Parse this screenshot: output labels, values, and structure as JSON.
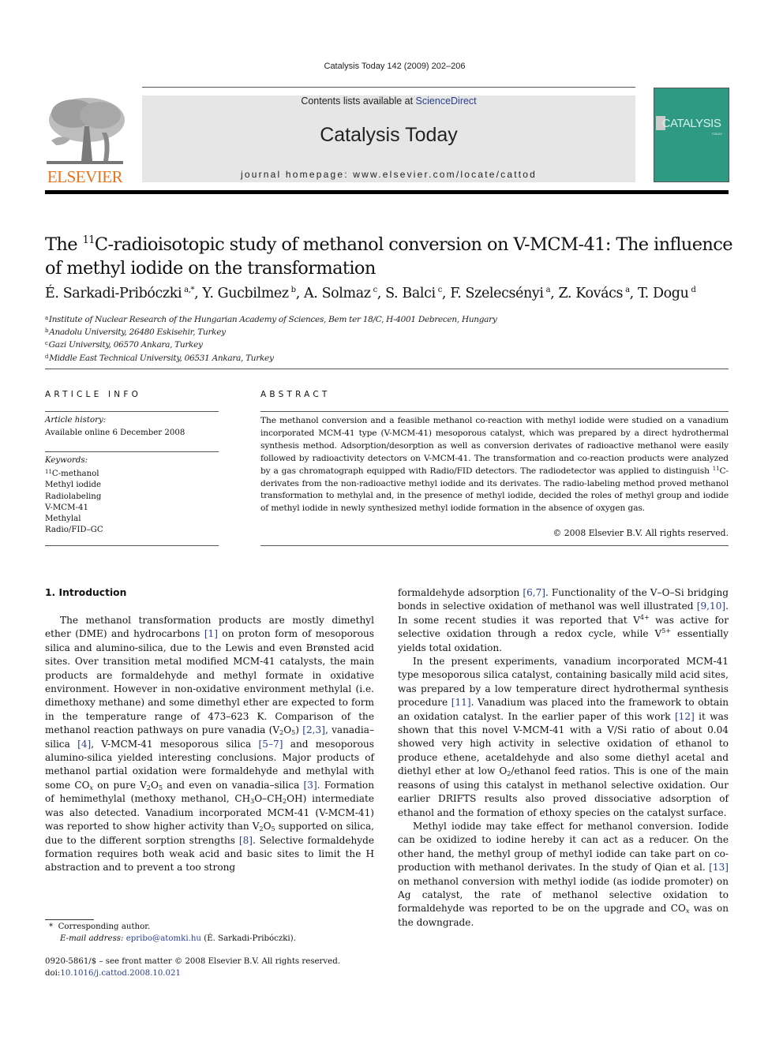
{
  "running_head": "Catalysis Today 142 (2009) 202–206",
  "publisher": {
    "logo_text": "ELSEVIER",
    "logo_icon": "elsevier-tree-icon",
    "brand_color": "#e8731a"
  },
  "banner": {
    "contents_prefix": "Contents lists available at ",
    "contents_link": "ScienceDirect",
    "journal_title": "Catalysis Today",
    "homepage": "journal homepage: www.elsevier.com/locate/cattod",
    "background_color": "#e6e6e6"
  },
  "cover": {
    "title": "CATALYSIS",
    "subtitle": "TODAY",
    "color": "#2e9a83"
  },
  "article": {
    "title_prefix": "The ",
    "title_sup": "11",
    "title_rest": "C-radioisotopic study of methanol conversion on V-MCM-41: The influence of methyl iodide on the transformation",
    "authors": [
      {
        "name": "É. Sarkadi-Pribóczki",
        "sup": "a,*"
      },
      {
        "name": "Y. Gucbilmez",
        "sup": "b"
      },
      {
        "name": "A. Solmaz",
        "sup": "c"
      },
      {
        "name": "S. Balci",
        "sup": "c"
      },
      {
        "name": "F. Szelecsényi",
        "sup": "a"
      },
      {
        "name": "Z. Kovács",
        "sup": "a"
      },
      {
        "name": "T. Dogu",
        "sup": "d"
      }
    ],
    "affiliations": [
      {
        "key": "a",
        "text": "Institute of Nuclear Research of the Hungarian Academy of Sciences, Bem ter 18/C, H-4001 Debrecen, Hungary"
      },
      {
        "key": "b",
        "text": "Anadolu University, 26480 Eskisehir, Turkey"
      },
      {
        "key": "c",
        "text": "Gazi University, 06570 Ankara, Turkey"
      },
      {
        "key": "d",
        "text": "Middle East Technical University, 06531 Ankara, Turkey"
      }
    ]
  },
  "article_info": {
    "heading": "ARTICLE INFO",
    "history_label": "Article history:",
    "history_value": "Available online 6 December 2008",
    "keywords_label": "Keywords:",
    "keywords": [
      "C-methanol",
      "Methyl iodide",
      "Radiolabeling",
      "V-MCM-41",
      "Methylal",
      "Radio/FID–GC"
    ],
    "keyword0_sup": "11"
  },
  "abstract": {
    "heading": "ABSTRACT",
    "part1": "The methanol conversion and a feasible methanol co-reaction with methyl iodide were studied on a vanadium incorporated MCM-41 type (V-MCM-41) mesoporous catalyst, which was prepared by a direct hydrothermal synthesis method. Adsorption/desorption as well as conversion derivates of radioactive methanol were easily followed by radioactivity detectors on V-MCM-41. The transformation and co-reaction products were analyzed by a gas chromatograph equipped with Radio/FID detectors. The radiodetector was applied to distinguish ",
    "sup": "11",
    "part2": "C-derivates from the non-radioactive methyl iodide and its derivates. The radio-labeling method proved methanol transformation to methylal and, in the presence of methyl iodide, decided the roles of methyl group and iodide of methyl iodide in newly synthesized methyl iodide formation in the absence of oxygen gas.",
    "copyright": "© 2008 Elsevier B.V. All rights reserved."
  },
  "introduction": {
    "heading": "1.  Introduction",
    "left": {
      "t1": "The methanol transformation products are mostly dimethyl ether (DME) and hydrocarbons ",
      "r1": "[1]",
      "t2": " on proton form of mesoporous silica and alumino-silica, due to the Lewis and even Brønsted acid sites. Over transition metal modified MCM-41 catalysts, the main products are formaldehyde and methyl formate in oxidative environment. However in non-oxidative environment methylal (i.e. dimethoxy methane) and some dimethyl ether are expected to form in the temperature range of 473–623 K. Comparison of the methanol reaction pathways on pure vanadia (V",
      "s1": "2",
      "t3": "O",
      "s2": "5",
      "t4": ") ",
      "r2": "[2,3]",
      "t5": ", vanadia–silica ",
      "r3": "[4]",
      "t6": ", V-MCM-41 mesoporous silica ",
      "r4": "[5–7]",
      "t7": " and mesoporous alumino-silica yielded interesting conclusions. Major products of methanol partial oxidation were formaldehyde and methylal with some CO",
      "s3": "x",
      "t8": " on pure V",
      "s4": "2",
      "t9": "O",
      "s5": "5",
      "t10": " and even on vanadia–silica ",
      "r5": "[3]",
      "t11": ". Formation of hemimethylal (methoxy methanol, CH",
      "s6": "3",
      "t12": "O–CH",
      "s7": "2",
      "t13": "OH) intermediate was also detected. Vanadium incorporated MCM-41 (V-MCM-41) was reported to show higher activity than V",
      "s8": "2",
      "t14": "O",
      "s9": "5",
      "t15": " supported on silica, due to the different sorption strengths ",
      "r6": "[8]",
      "t16": ". Selective formaldehyde formation requires both weak acid and basic sites to limit the H abstraction and to prevent a too strong"
    },
    "right": {
      "p1_t1": "formaldehyde adsorption ",
      "p1_r1": "[6,7]",
      "p1_t2": ". Functionality of the V–O–Si bridging bonds in selective oxidation of methanol was well illustrated ",
      "p1_r2": "[9,10]",
      "p1_t3": ". In some recent studies it was reported that V",
      "p1_sup1": "4+",
      "p1_t4": " was active for selective oxidation through a redox cycle, while V",
      "p1_sup2": "5+",
      "p1_t5": " essentially yields total oxidation.",
      "p2_t1": "In the present experiments, vanadium incorporated MCM-41 type mesoporous silica catalyst, containing basically mild acid sites, was prepared by a low temperature direct hydrothermal synthesis procedure ",
      "p2_r1": "[11]",
      "p2_t2": ". Vanadium was placed into the framework to obtain an oxidation catalyst. In the earlier paper of this work ",
      "p2_r2": "[12]",
      "p2_t3": " it was shown that this novel V-MCM-41 with a V/Si ratio of about 0.04 showed very high activity in selective oxidation of ethanol to produce ethene, acetaldehyde and also some diethyl acetal and diethyl ether at low O",
      "p2_sub": "2",
      "p2_t4": "/ethanol feed ratios. This is one of the main reasons of using this catalyst in methanol selective oxidation. Our earlier DRIFTS results also proved dissociative adsorption of ethanol and the formation of ethoxy species on the catalyst surface.",
      "p3_t1": "Methyl iodide may take effect for methanol conversion. Iodide can be oxidized to iodine hereby it can act as a reducer. On the other hand, the methyl group of methyl iodide can take part on co-production with methanol derivates. In the study of Qian et al. ",
      "p3_r1": "[13]",
      "p3_t2": " on methanol conversion with methyl iodide (as iodide promoter) on Ag catalyst, the rate of methanol selective oxidation to formaldehyde was reported to be on the upgrade and CO",
      "p3_sub": "x",
      "p3_t3": " was on the downgrade."
    }
  },
  "footnote": {
    "star": "*",
    "corresponding": "Corresponding author.",
    "email_label": "E-mail address: ",
    "email": "epribo@atomki.hu",
    "email_name": " (É. Sarkadi-Pribóczki)."
  },
  "bottom": {
    "issn_line": "0920-5861/$ – see front matter © 2008 Elsevier B.V. All rights reserved.",
    "doi_prefix": "doi:",
    "doi": "10.1016/j.cattod.2008.10.021"
  },
  "link_color": "#2a3f8f"
}
